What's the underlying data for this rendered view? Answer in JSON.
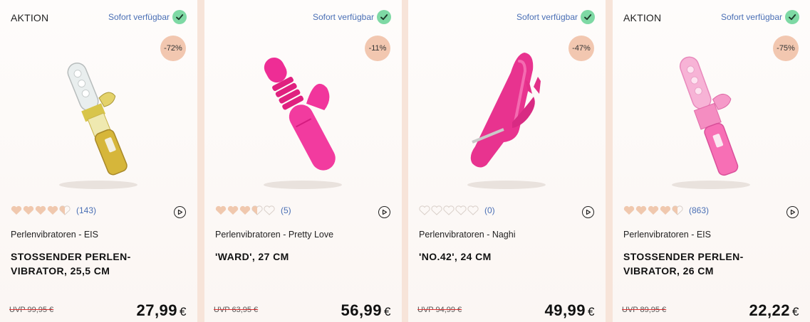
{
  "colors": {
    "background": "#f7e4d9",
    "availability_text": "#4a6fb5",
    "check_badge": "#7ed9a4",
    "discount_badge": "#f2c7b0",
    "heart_filled": "#f0c8ae",
    "strike": "#d33333"
  },
  "products": [
    {
      "promo_label": "AKTION",
      "availability": "Sofort verfügbar",
      "discount": "-72%",
      "rating": 4.5,
      "rating_count": "(143)",
      "category": "Perlenvibratoren - EIS",
      "title": "STOSSENDER PERLEN-VIBRATOR, 25,5 CM",
      "uvp": "UVP 99,95 €",
      "price": "27,99",
      "currency": "€",
      "image_icon": "gold-clear-rabbit-vibrator"
    },
    {
      "promo_label": "",
      "availability": "Sofort verfügbar",
      "discount": "-11%",
      "rating": 3.5,
      "rating_count": "(5)",
      "category": "Perlenvibratoren - Pretty Love",
      "title": "'WARD', 27 CM",
      "uvp": "UVP 63,95 €",
      "price": "56,99",
      "currency": "€",
      "image_icon": "pink-thrusting-rabbit-vibrator"
    },
    {
      "promo_label": "",
      "availability": "Sofort verfügbar",
      "discount": "-47%",
      "rating": 0,
      "rating_count": "(0)",
      "category": "Perlenvibratoren - Naghi",
      "title": "'NO.42', 24 CM",
      "uvp": "UVP 94,99 €",
      "price": "49,99",
      "currency": "€",
      "image_icon": "magenta-curved-rabbit-vibrator"
    },
    {
      "promo_label": "AKTION",
      "availability": "Sofort verfügbar",
      "discount": "-75%",
      "rating": 4.5,
      "rating_count": "(863)",
      "category": "Perlenvibratoren - EIS",
      "title": "STOSSENDER PERLEN-VIBRATOR, 26 CM",
      "uvp": "UVP 89,95 €",
      "price": "22,22",
      "currency": "€",
      "image_icon": "pink-clear-rabbit-vibrator"
    }
  ]
}
